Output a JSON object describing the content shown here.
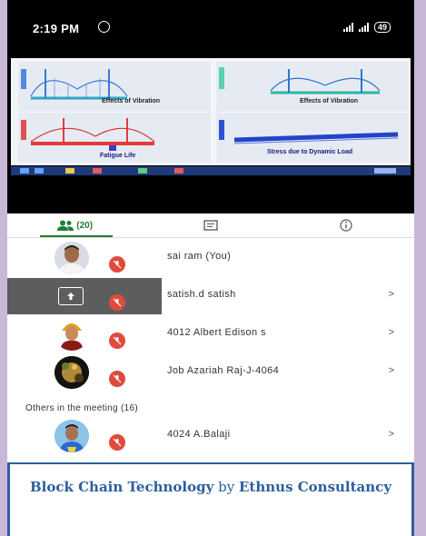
{
  "status_bar": {
    "time": "2:19 PM",
    "battery": "49"
  },
  "slide": {
    "labels": [
      "Effects of Vibration",
      "Effects of Vibration",
      "Fatigue Life",
      "Stress due to Dynamic Load"
    ]
  },
  "tabs": [
    {
      "icon": "people-icon",
      "label": "(20)",
      "active": true
    },
    {
      "icon": "chat-icon",
      "label": ""
    },
    {
      "icon": "info-icon",
      "label": ""
    }
  ],
  "participants": [
    {
      "name": "sai ram (You)",
      "muted": true
    },
    {
      "name": "satish.d satish",
      "muted": true
    },
    {
      "name": "4012 Albert Edison s",
      "muted": true
    },
    {
      "name": "Job Azariah Raj-J-4064",
      "muted": true
    }
  ],
  "others_header": "Others in the meeting (16)",
  "others": [
    {
      "name": "4024 A.Balaji",
      "muted": true
    }
  ],
  "caption": {
    "course": "Block Chain Technology",
    "by": "by",
    "org": "Ethnus Consultancy"
  },
  "colors": {
    "accent_green": "#1e7e34",
    "mute_red": "#e04a3c",
    "caption_blue": "#2c5f9e"
  }
}
